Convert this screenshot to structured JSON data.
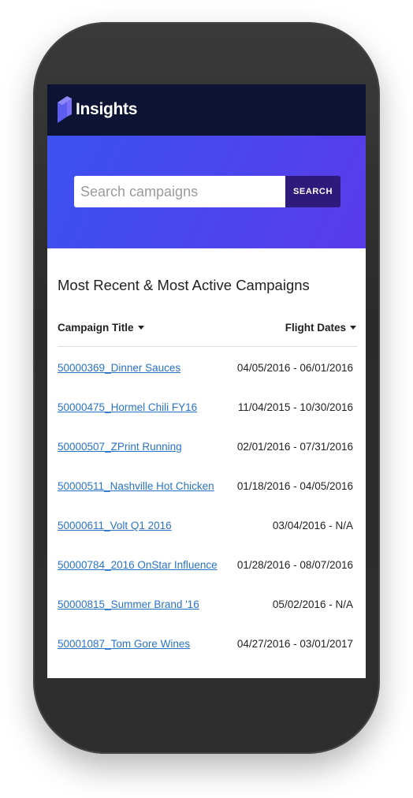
{
  "app": {
    "name": "Insights"
  },
  "search": {
    "placeholder": "Search campaigns",
    "value": "",
    "button_label": "SEARCH"
  },
  "section": {
    "title": "Most Recent & Most Active Campaigns"
  },
  "table": {
    "columns": [
      {
        "label": "Campaign Title",
        "sortable": true
      },
      {
        "label": "Flight Dates",
        "sortable": true
      }
    ],
    "rows": [
      {
        "title": "50000369_Dinner Sauces",
        "dates": "04/05/2016 - 06/01/2016"
      },
      {
        "title": "50000475_Hormel Chili FY16",
        "dates": "11/04/2015 - 10/30/2016"
      },
      {
        "title": "50000507_ZPrint Running",
        "dates": "02/01/2016 - 07/31/2016"
      },
      {
        "title": "50000511_Nashville Hot Chicken",
        "dates": "01/18/2016 - 04/05/2016"
      },
      {
        "title": "50000611_Volt Q1 2016",
        "dates": "03/04/2016 - N/A"
      },
      {
        "title": "50000784_2016 OnStar Influence",
        "dates": "01/28/2016 - 08/07/2016"
      },
      {
        "title": "50000815_Summer Brand '16",
        "dates": "05/02/2016 - N/A"
      },
      {
        "title": "50001087_Tom Gore Wines",
        "dates": "04/27/2016 - 03/01/2017"
      }
    ]
  },
  "colors": {
    "topbar": "#0d1333",
    "hero_start": "#3c52f0",
    "hero_end": "#5a3be9",
    "search_button": "#2d1a7a",
    "link": "#2a73c9",
    "logo_mark": "#5b5cf0"
  },
  "icons": {
    "logo": "insights-logo-icon",
    "sort": "caret-down-icon"
  }
}
